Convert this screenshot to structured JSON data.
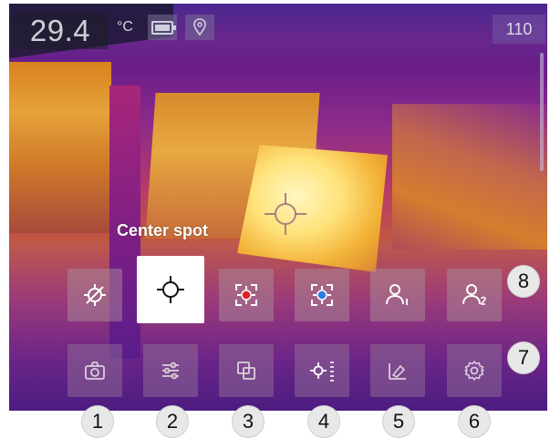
{
  "status": {
    "temperature": "29.4",
    "unit": "°C",
    "battery_icon": "battery-icon",
    "location_icon": "location-icon",
    "counter": "110"
  },
  "tooltip": "Center spot",
  "measurement_row": [
    {
      "icon": "no-measurement-icon",
      "active": false
    },
    {
      "icon": "center-spot-icon",
      "active": true
    },
    {
      "icon": "hot-spot-icon",
      "active": false
    },
    {
      "icon": "cold-spot-icon",
      "active": false
    },
    {
      "icon": "user-spot-1-icon",
      "active": false
    },
    {
      "icon": "user-spot-2-icon",
      "active": false
    }
  ],
  "toolbar_row": [
    {
      "icon": "camera-icon"
    },
    {
      "icon": "sliders-icon"
    },
    {
      "icon": "image-mode-icon"
    },
    {
      "icon": "measurement-icon"
    },
    {
      "icon": "color-palette-icon"
    },
    {
      "icon": "settings-gear-icon"
    }
  ],
  "callouts": {
    "c1": "1",
    "c2": "2",
    "c3": "3",
    "c4": "4",
    "c5": "5",
    "c6": "6",
    "c7": "7",
    "c8": "8"
  },
  "colors": {
    "accent_red": "#e01e2a",
    "accent_blue": "#2d7ce0",
    "button_bg": "#a98c96",
    "active_bg": "#ffffff"
  }
}
